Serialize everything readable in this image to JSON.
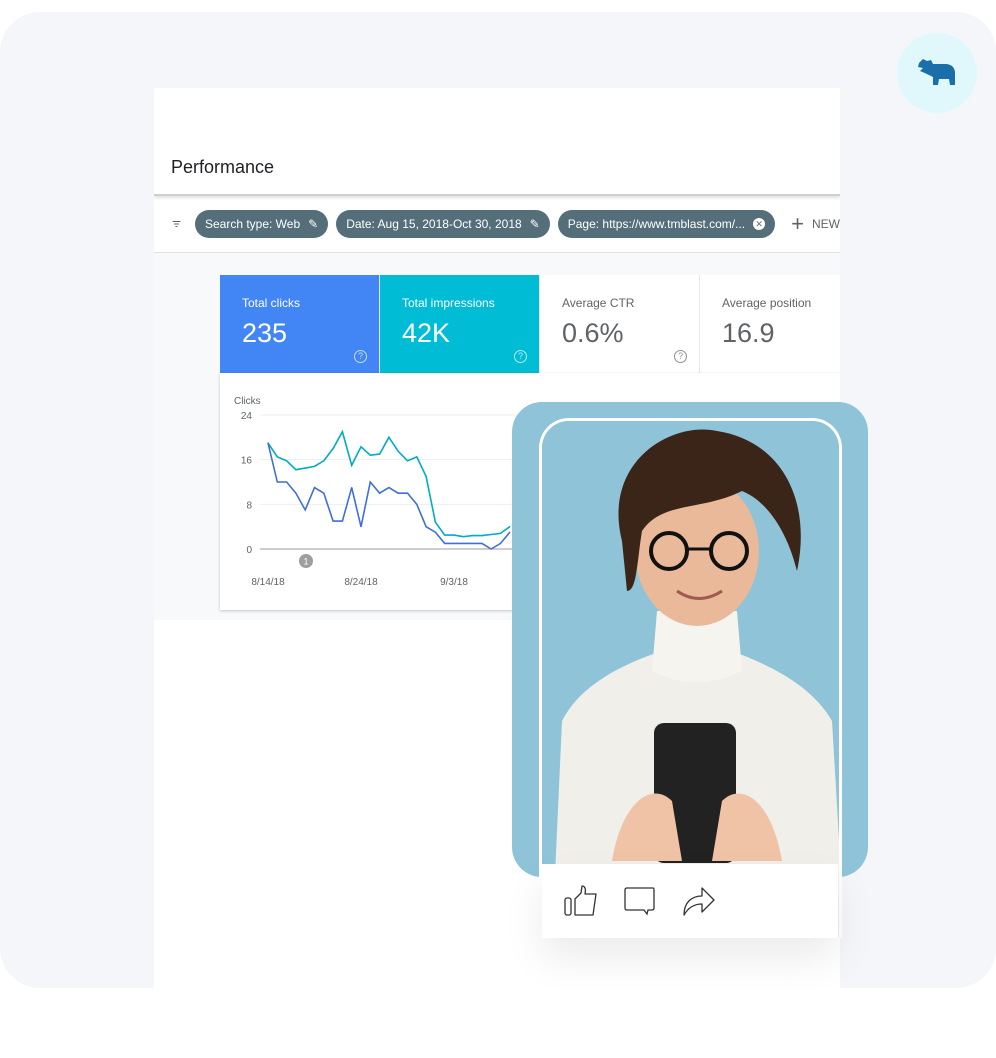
{
  "brand": {
    "logo_icon": "hippo-icon",
    "logo_bg": "#e0f8fc",
    "logo_color": "#1a6fa8"
  },
  "header": {
    "title": "Performance"
  },
  "filters": {
    "chips": [
      {
        "label": "Search type: Web",
        "icon": "pencil-icon"
      },
      {
        "label": "Date: Aug 15, 2018-Oct 30, 2018",
        "icon": "pencil-icon"
      },
      {
        "label": "Page: https://www.tmblast.com/...",
        "icon": "close-circle-icon"
      }
    ],
    "new_label": "NEW"
  },
  "metrics": [
    {
      "label": "Total clicks",
      "value": "235",
      "color": "#4285f4"
    },
    {
      "label": "Total impressions",
      "value": "42K",
      "color": "#00bcd4"
    },
    {
      "label": "Average CTR",
      "value": "0.6%"
    },
    {
      "label": "Average position",
      "value": "16.9"
    }
  ],
  "chart_data": {
    "type": "line",
    "ylabel": "Clicks",
    "ylim": [
      0,
      24
    ],
    "yticks": [
      "24",
      "16",
      "8",
      "0"
    ],
    "xticks": [
      "8/14/18",
      "8/24/18",
      "9/3/18"
    ],
    "annotation": "1",
    "grid": true,
    "series": [
      {
        "color": "#00acc1",
        "values": [
          19,
          16.5,
          15.8,
          14.2,
          14.5,
          14.8,
          15.8,
          18,
          21,
          15,
          18.3,
          16.8,
          17,
          20,
          17.5,
          15.8,
          16.5,
          13,
          4.8,
          2.5,
          2.5,
          2.2,
          2.4,
          2.4,
          2.6,
          2.8,
          4
        ]
      },
      {
        "color": "#3f6fd8",
        "values": [
          19,
          12,
          12,
          10,
          7,
          11,
          10,
          5,
          5,
          11,
          4,
          12,
          10,
          11,
          10,
          10,
          8,
          4,
          3,
          1,
          1,
          1,
          1,
          1,
          0,
          1,
          3
        ]
      }
    ]
  },
  "social": {
    "icons": [
      "thumbs-up-icon",
      "comment-icon",
      "share-icon"
    ]
  }
}
